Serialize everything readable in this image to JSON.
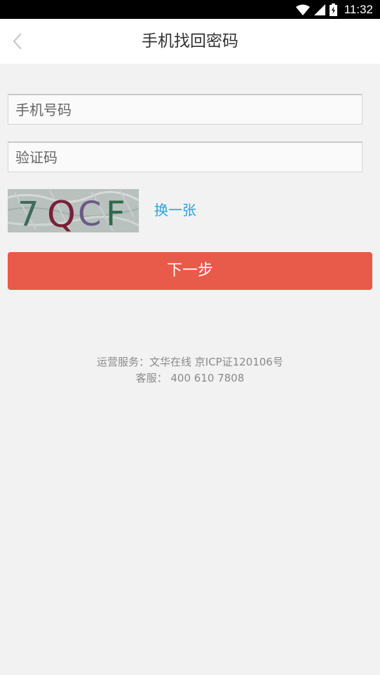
{
  "status_bar": {
    "time": "11:32",
    "icons": [
      "wifi-icon",
      "signal-icon",
      "battery-icon"
    ]
  },
  "header": {
    "title": "手机找回密码",
    "back_icon": "chevron-left-icon"
  },
  "form": {
    "phone_placeholder": "手机号码",
    "code_placeholder": "验证码",
    "captcha_text": "7QCF",
    "refresh_label": "换一张",
    "next_label": "下一步"
  },
  "footer": {
    "line1": "运营服务：文华在线 京ICP证120106号",
    "line2": "客服： 400 610 7808"
  },
  "colors": {
    "accent": "#e85a49",
    "link": "#2aa3dd",
    "background": "#f2f2f2"
  }
}
